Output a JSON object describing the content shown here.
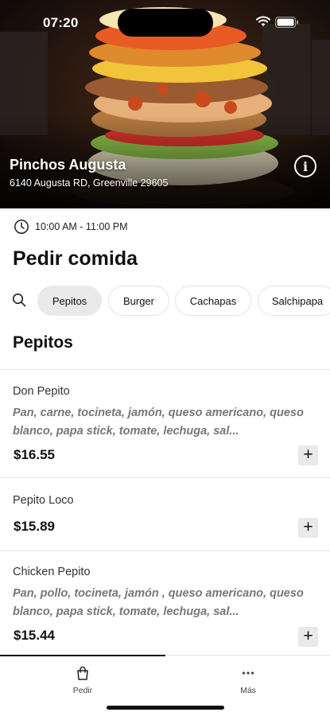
{
  "status_bar": {
    "time": "07:20"
  },
  "store": {
    "name": "Pinchos Augusta",
    "address": "6140 Augusta RD, Greenville 29605",
    "hours": "10:00 AM - 11:00 PM"
  },
  "page_title": "Pedir comida",
  "categories": [
    "Pepitos",
    "Burger",
    "Cachapas",
    "Salchipapa"
  ],
  "selected_category": "Pepitos",
  "section_title": "Pepitos",
  "items": [
    {
      "name": "Don Pepito",
      "description": "Pan, carne, tocineta, jamón, queso americano, queso blanco, papa stick, tomate, lechuga, sal...",
      "price": "$16.55"
    },
    {
      "name": "Pepito Loco",
      "description": "",
      "price": "$15.89"
    },
    {
      "name": "Chicken Pepito",
      "description": "Pan, pollo, tocineta, jamón , queso americano, queso blanco, papa stick, tomate, lechuga, sal...",
      "price": "$15.44"
    }
  ],
  "add_label": "+",
  "tabs": [
    {
      "label": "Pedir",
      "icon": "bag-icon"
    },
    {
      "label": "Más",
      "icon": "more-dots-icon"
    }
  ],
  "colors": {
    "accent": "#111111",
    "chip_active": "#e9e9e9",
    "muted_text": "#777777"
  }
}
